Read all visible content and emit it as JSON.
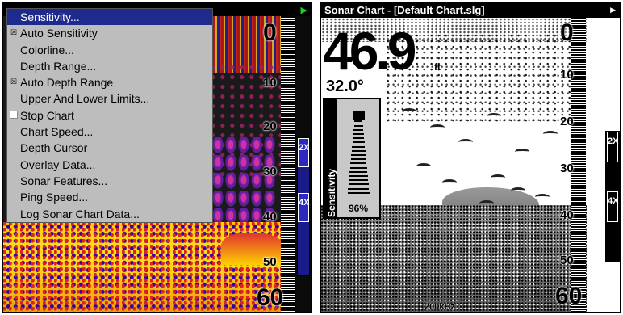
{
  "left": {
    "menu": {
      "items": [
        {
          "label": "Sensitivity...",
          "mark": "",
          "selected": true
        },
        {
          "label": "Auto Sensitivity",
          "mark": "x"
        },
        {
          "label": "Colorline...",
          "mark": ""
        },
        {
          "label": "Depth Range...",
          "mark": ""
        },
        {
          "label": "Auto Depth Range",
          "mark": "x"
        },
        {
          "label": "Upper And Lower Limits...",
          "mark": ""
        },
        {
          "label": "Stop Chart",
          "mark": "box"
        },
        {
          "label": "Chart Speed...",
          "mark": ""
        },
        {
          "label": "Depth Cursor",
          "mark": ""
        },
        {
          "label": "Overlay Data...",
          "mark": ""
        },
        {
          "label": "Sonar Features...",
          "mark": ""
        },
        {
          "label": "Ping Speed...",
          "mark": ""
        },
        {
          "label": "Log Sonar Chart Data...",
          "mark": ""
        }
      ]
    },
    "scale": {
      "top": "0",
      "d10": "10",
      "d20": "20",
      "d30": "30",
      "d40": "40",
      "d50": "50",
      "bottom": "60"
    },
    "zoom": {
      "z2": "2X",
      "z4": "4X"
    }
  },
  "right": {
    "title": "Sonar Chart - [Default Chart.slg]",
    "depth": "46.9",
    "depth_unit": "ft",
    "temperature": "32.0°",
    "sensitivity": {
      "label": "Sensitivity",
      "value": "96%",
      "level": 0.96
    },
    "frequency": "200kHz",
    "scale": {
      "top": "0",
      "d10": "10",
      "d20": "20",
      "d30": "30",
      "d40": "40",
      "d50": "50",
      "bottom": "60"
    },
    "zoom": {
      "z2": "2X",
      "z4": "4X"
    }
  },
  "colors": {
    "menu_highlight": "#1e2a8c",
    "menu_bg": "#bdbdbd",
    "zoom_left": "#2a2ac0",
    "play_icon": "#22cc22"
  },
  "icons": {
    "play": "play-triangle-icon",
    "right_arrow": "right-arrow-icon"
  }
}
